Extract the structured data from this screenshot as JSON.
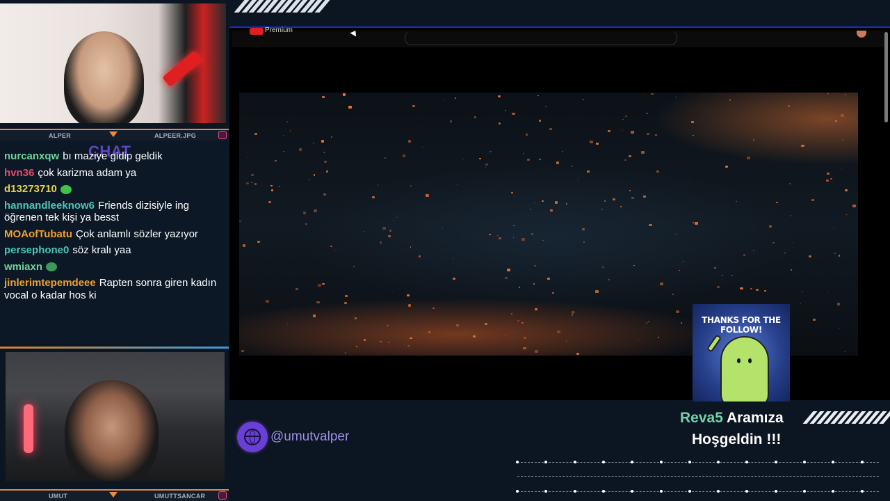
{
  "overlay": {
    "cam_top": {
      "left_name": "ALPER",
      "right_name": "ALPEER.JPG"
    },
    "cam_bottom": {
      "left_name": "UMUT",
      "right_name": "UMUTTSANCAR"
    },
    "chat_title": "CHAT",
    "chat": [
      {
        "user": "nurcanxqw",
        "color": "#6fd39a",
        "text": "bı maziye gidip geldik"
      },
      {
        "user": "hvn36",
        "color": "#e64a6a",
        "text": "çok karizma adam ya"
      },
      {
        "user": "d13273710",
        "color": "#e6d24a",
        "text": ""
      },
      {
        "user": "hannandleeknow6",
        "color": "#4ac6b8",
        "text": "Friends dizisiyle ing öğrenen tek kişi ya besst"
      },
      {
        "user": "MOAofTubatu",
        "color": "#f0a030",
        "text": "Çok anlamlı sözler yazıyor"
      },
      {
        "user": "persephone0",
        "color": "#4ac6b8",
        "text": "söz kralı yaa"
      },
      {
        "user": "wmiaxn",
        "color": "#6fd39a",
        "text": ""
      },
      {
        "user": "jinlerimtepemdeee",
        "color": "#f0a030",
        "text": "Rapten sonra giren kadın vocal o kadar hos ki"
      }
    ],
    "social_handle": "@umutvalper",
    "follow_alert": {
      "image_text": "THANKS FOR THE FOLLOW!",
      "username": "Reva5",
      "message_line1": "Aramıza",
      "message_line2": "Hoşgeldin !!!"
    }
  },
  "youtube": {
    "brand_label": "Premium"
  },
  "colors": {
    "background": "#0c1522",
    "accent_purple": "#6a3fd6",
    "accent_orange": "#f08a3a",
    "alert_username": "#6fd3a8"
  }
}
